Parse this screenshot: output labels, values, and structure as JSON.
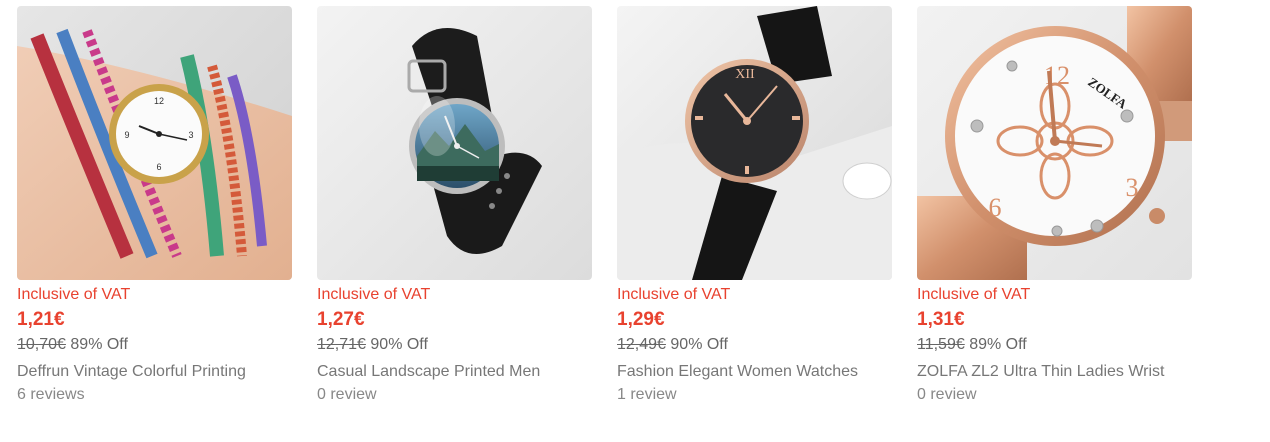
{
  "products": [
    {
      "vat_label": "Inclusive of VAT",
      "price": "1,21€",
      "original_price": "10,70€",
      "discount": "89% Off",
      "title": "Deffrun Vintage Colorful Printing",
      "reviews": "6 reviews",
      "image_icon": "bracelet-watch-icon"
    },
    {
      "vat_label": "Inclusive of VAT",
      "price": "1,27€",
      "original_price": "12,71€",
      "discount": "90% Off",
      "title": "Casual Landscape Printed Men",
      "reviews": "0 review",
      "image_icon": "landscape-watch-icon"
    },
    {
      "vat_label": "Inclusive of VAT",
      "price": "1,29€",
      "original_price": "12,49€",
      "discount": "90% Off",
      "title": "Fashion Elegant Women Watches",
      "reviews": "1 review",
      "image_icon": "black-leather-watch-icon"
    },
    {
      "vat_label": "Inclusive of VAT",
      "price": "1,31€",
      "original_price": "11,59€",
      "discount": "89% Off",
      "title": "ZOLFA ZL2 Ultra Thin Ladies Wrist",
      "reviews": "0 review",
      "image_icon": "rose-gold-watch-icon",
      "dial_brand": "ZOLFA"
    }
  ],
  "colors": {
    "price_red": "#e8422f",
    "text_gray": "#777777"
  }
}
